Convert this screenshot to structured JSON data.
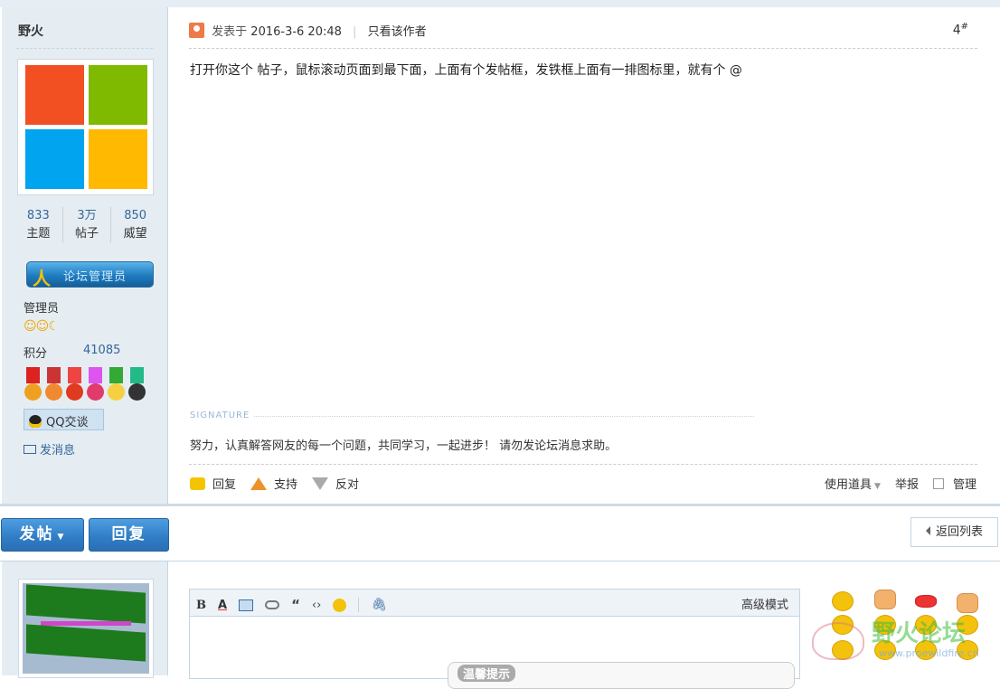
{
  "post": {
    "author": "野火",
    "stats": [
      {
        "num": "833",
        "label": "主题"
      },
      {
        "num": "3万",
        "label": "帖子"
      },
      {
        "num": "850",
        "label": "威望"
      }
    ],
    "admin_badge": "论坛管理员",
    "group": "管理员",
    "points_label": "积分",
    "points_value": "41085",
    "qq_label": "QQ交谈",
    "message_label": "发消息",
    "posted_prefix": "发表于",
    "posted_time": "2016-3-6 20:48",
    "only_author": "只看该作者",
    "floor": "4",
    "floor_sup": "#",
    "content": "打开你这个 帖子，鼠标滚动页面到最下面，上面有个发帖框，发铁框上面有一排图标里，就有个 @",
    "signature_label": "SIGNATURE",
    "signature": "努力，认真解答网友的每一个问题，共同学习，一起进步！  请勿发论坛消息求助。",
    "actions": {
      "reply": "回复",
      "support": "支持",
      "oppose": "反对"
    },
    "tools": {
      "use_tool": "使用道具",
      "report": "举报",
      "manage": "管理"
    }
  },
  "bar": {
    "post_button": "发帖",
    "reply_button": "回复",
    "back_button": "返回列表"
  },
  "editor": {
    "advanced_mode": "高级模式",
    "tip": "温馨提示"
  },
  "watermark": {
    "text": "野火论坛",
    "url": "www.proewildfire.cn"
  },
  "colors": {
    "accent": "#2f7cc5",
    "sidebar_bg": "#e5edf2",
    "link": "#336699"
  }
}
